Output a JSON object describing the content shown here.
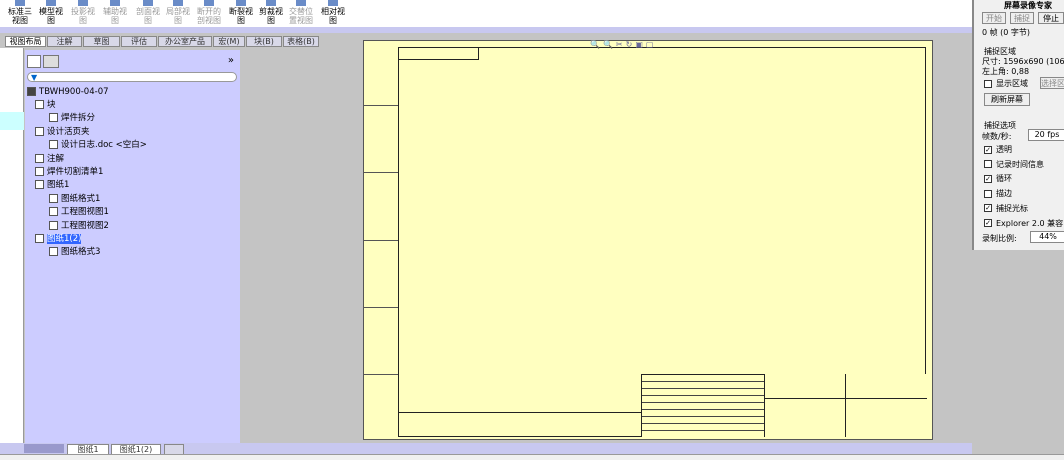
{
  "toolbar": {
    "buttons": [
      {
        "label": "标准三视图",
        "dis": false
      },
      {
        "label": "模型视图",
        "dis": false
      },
      {
        "label": "投影视图",
        "dis": true
      },
      {
        "label": "辅助视图",
        "dis": true
      },
      {
        "label": "剖面视图",
        "dis": true
      },
      {
        "label": "局部视图",
        "dis": true
      },
      {
        "label": "断开的剖视图",
        "dis": true
      },
      {
        "label": "断裂视图",
        "dis": false
      },
      {
        "label": "剪裁视图",
        "dis": false
      },
      {
        "label": "交替位置视图",
        "dis": true
      },
      {
        "label": "相对视图",
        "dis": false
      }
    ]
  },
  "tabs": [
    "视图布局",
    "注解",
    "草图",
    "评估",
    "办公室产品",
    "宏(M)",
    "块(B)",
    "表格(B)"
  ],
  "tree": {
    "root": "TBWH900-04-07",
    "nodes": [
      {
        "label": "块",
        "level": 0
      },
      {
        "label": "焊件拆分",
        "level": 1
      },
      {
        "label": "设计活页夹",
        "level": 0
      },
      {
        "label": "设计日志.doc <空白>",
        "level": 1
      },
      {
        "label": "注解",
        "level": 0
      },
      {
        "label": "焊件切割清单1",
        "level": 0
      },
      {
        "label": "图纸1",
        "level": 0
      },
      {
        "label": "图纸格式1",
        "level": 1
      },
      {
        "label": "工程图视图1",
        "level": 1
      },
      {
        "label": "工程图视图2",
        "level": 1
      },
      {
        "label": "图纸1(2)",
        "level": 0,
        "selected": true
      },
      {
        "label": "图纸格式3",
        "level": 1
      }
    ],
    "expand": "»"
  },
  "sheet_tabs": [
    "图纸1",
    "图纸1(2)"
  ],
  "recorder": {
    "title": "屏幕录像专家",
    "start": "开始",
    "capture": "捕捉",
    "stop": "停止",
    "frames": "0 帧 (0 字节)",
    "area_header": "捕捉区域",
    "size": "尺寸: 1596x690 (106",
    "topleft": "左上角: 0,88",
    "show_area": "显示区域",
    "select_area": "选择区",
    "refresh": "刷新屏幕",
    "opt_header": "捕捉选项",
    "fps_label": "帧数/秒:",
    "fps": "20 fps",
    "options": [
      {
        "label": "透明",
        "checked": true
      },
      {
        "label": "记录时间信息",
        "checked": false
      },
      {
        "label": "循环",
        "checked": true
      },
      {
        "label": "描边",
        "checked": false
      },
      {
        "label": "捕捉光标",
        "checked": true
      },
      {
        "label": "Explorer 2.0 兼容",
        "checked": true
      }
    ],
    "ratio_label": "录制比例:",
    "ratio": "44%"
  }
}
